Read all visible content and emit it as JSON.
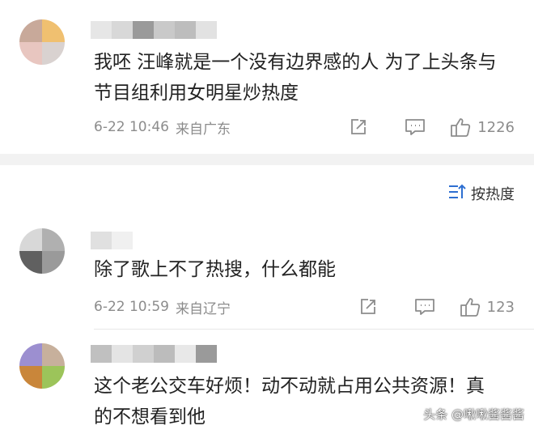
{
  "comments": [
    {
      "text": "我呸 汪峰就是一个没有边界感的人 为了上头条与节目组利用女明星炒热度",
      "time": "6-22 10:46",
      "location": "来自广东",
      "likes": "1226"
    },
    {
      "text": "除了歌上不了热搜，什么都能",
      "time": "6-22 10:59",
      "location": "来自辽宁",
      "likes": "123"
    },
    {
      "text": "这个老公交车好烦！动不动就占用公共资源！真的不想看到他"
    }
  ],
  "sort": {
    "label": "按热度"
  },
  "watermark": "头条 @啾啾酱酱酱",
  "colors": {
    "text": "#222222",
    "meta": "#8c8c8c",
    "separator": "#f2f2f2",
    "accent": "#2e6fd1"
  },
  "icons": [
    "share-icon",
    "comment-icon",
    "like-icon",
    "sort-icon"
  ]
}
